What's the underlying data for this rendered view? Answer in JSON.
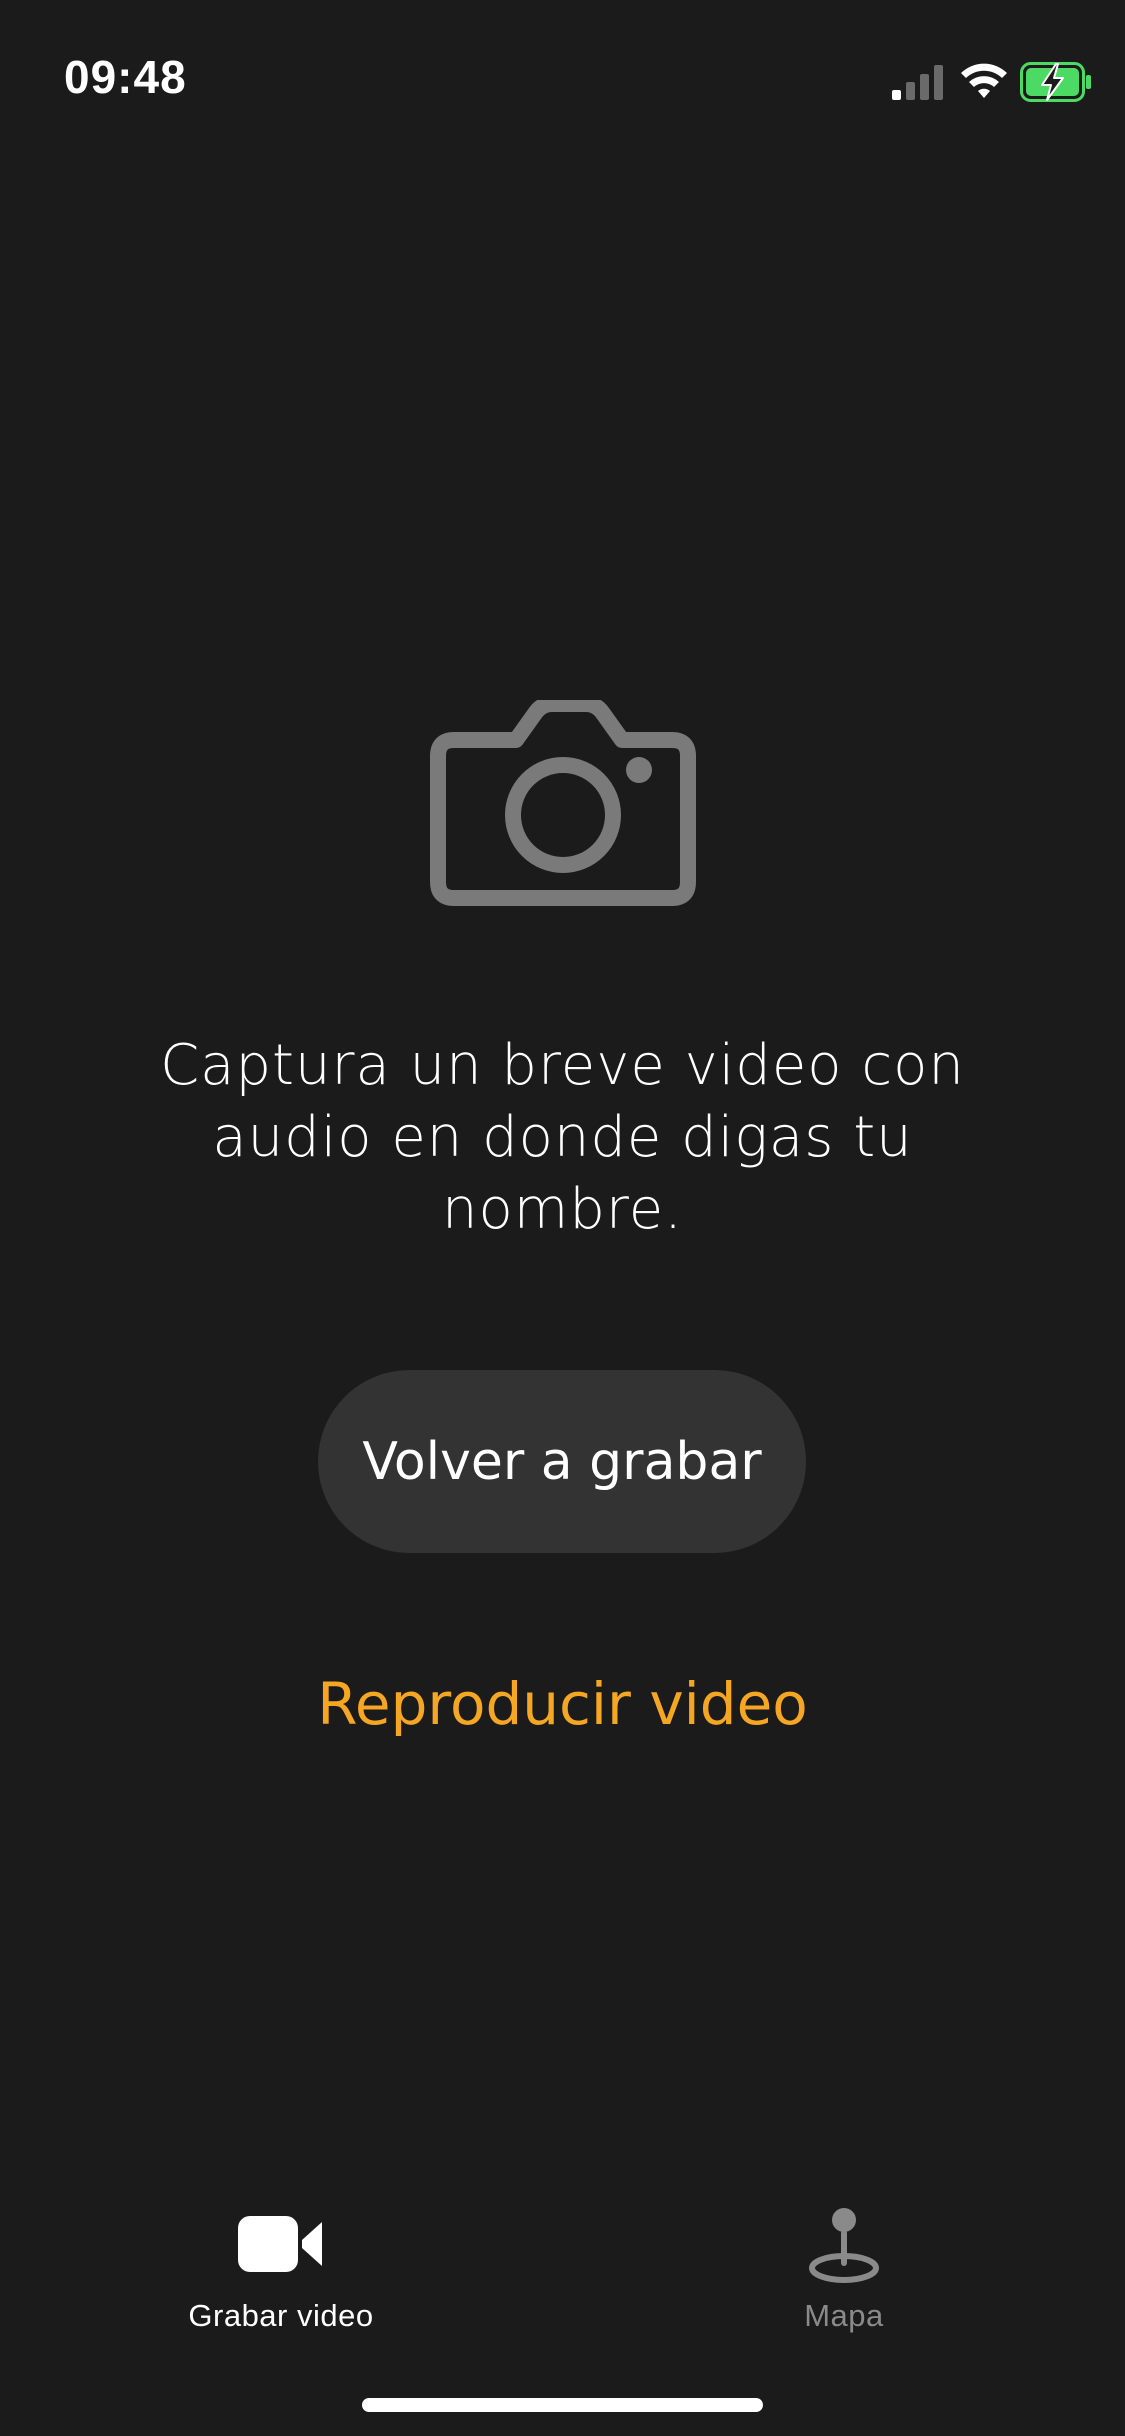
{
  "status_bar": {
    "time": "09:48",
    "signal_icon": "cellular-signal-icon",
    "wifi_icon": "wifi-icon",
    "battery_icon": "battery-charging-icon",
    "battery_color": "#4cd964"
  },
  "main": {
    "icon": "camera-icon",
    "instruction": "Captura un breve video con audio en donde digas tu nombre.",
    "rerecord_label": "Volver a grabar",
    "play_label": "Reproducir video"
  },
  "tabs": [
    {
      "label": "Grabar video",
      "icon": "video-camera-icon",
      "active": true
    },
    {
      "label": "Mapa",
      "icon": "map-pin-icon",
      "active": false
    }
  ],
  "colors": {
    "background": "#1b1b1b",
    "accent": "#f5a623",
    "button": "#333333",
    "icon_muted": "#7a7a7a",
    "tab_inactive": "#8a8a8a"
  }
}
